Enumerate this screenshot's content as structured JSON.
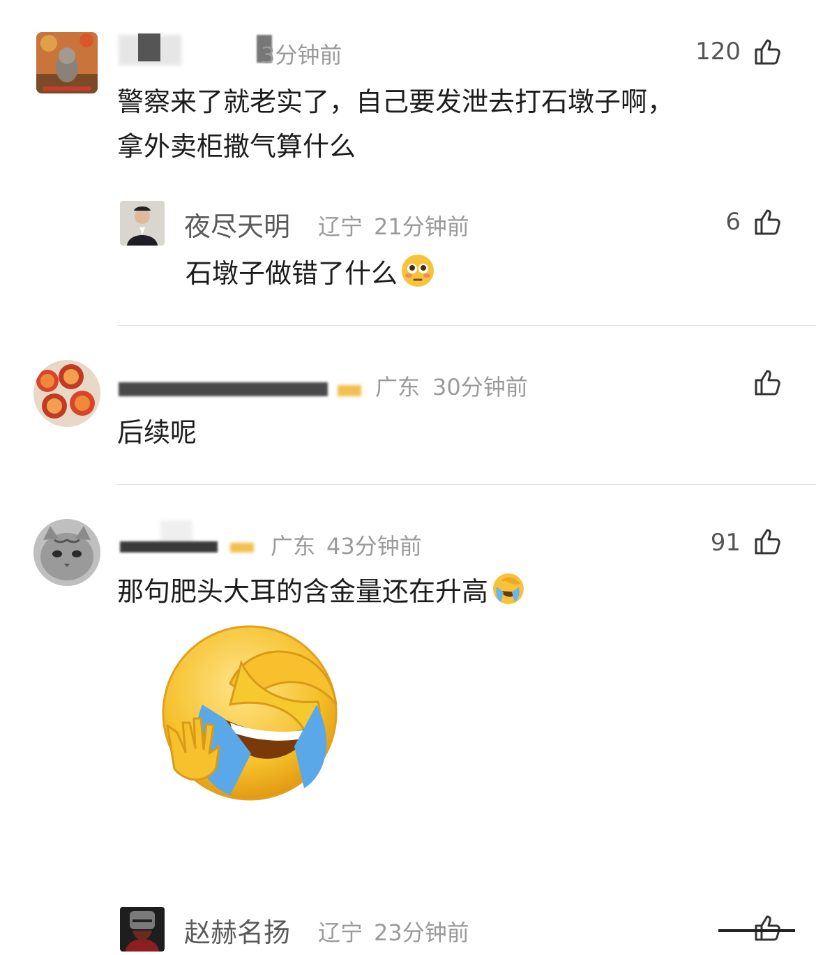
{
  "comments": [
    {
      "name_visible": "",
      "time": "3分钟前",
      "likes": "120",
      "lines": [
        "警察来了就老实了，自己要发泄去打石墩子啊，",
        "拿外卖柜撒气算什么"
      ],
      "reply": {
        "name": "夜尽天明",
        "location": "辽宁",
        "time": "21分钟前",
        "likes": "6",
        "text": "石墩子做错了什么"
      }
    },
    {
      "location": "广东",
      "time": "30分钟前",
      "likes": "",
      "text": "后续呢"
    },
    {
      "location": "广东",
      "time": "43分钟前",
      "likes": "91",
      "text": "那句肥头大耳的含金量还在升高"
    },
    {
      "name": "赵赫名扬",
      "location": "辽宁",
      "time": "23分钟前"
    }
  ],
  "icons": {
    "like": "thumbs-up-icon",
    "flushed": "flushed-face-emoji",
    "laughing_crying": "laughing-crying-emoji"
  }
}
